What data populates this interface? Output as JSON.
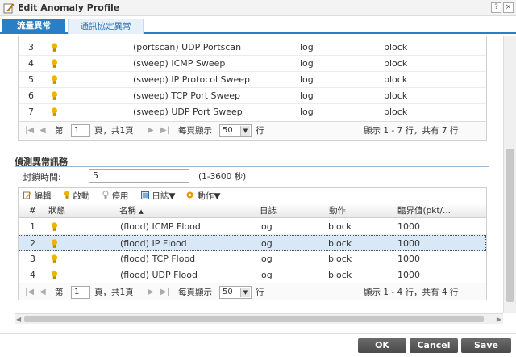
{
  "window": {
    "title": "Edit Anomaly Profile",
    "help_glyph": "?",
    "close_glyph": "×"
  },
  "tabs": [
    {
      "label": "流量異常"
    },
    {
      "label": "通訊協定異常"
    }
  ],
  "upper_table": {
    "rows": [
      {
        "no": "3",
        "name": "(portscan) UDP Portscan",
        "log": "log",
        "action": "block"
      },
      {
        "no": "4",
        "name": "(sweep) ICMP Sweep",
        "log": "log",
        "action": "block"
      },
      {
        "no": "5",
        "name": "(sweep) IP Protocol Sweep",
        "log": "log",
        "action": "block"
      },
      {
        "no": "6",
        "name": "(sweep) TCP Port Sweep",
        "log": "log",
        "action": "block"
      },
      {
        "no": "7",
        "name": "(sweep) UDP Port Sweep",
        "log": "log",
        "action": "block"
      }
    ],
    "pager": {
      "page_label": "第",
      "page_value": "1",
      "page_of": "頁，共1頁",
      "per_page_label": "每頁顯示",
      "per_page_value": "50",
      "per_page_unit": "行",
      "summary": "顯示 1 - 7 行，共有 7 行"
    }
  },
  "detect": {
    "section_title": "偵測異常訊務",
    "block_label": "封鎖時間:",
    "block_value": "5",
    "block_range": "(1-3600 秒)"
  },
  "lower_table": {
    "toolbar": {
      "edit": "編輯",
      "activate": "啟動",
      "deactivate": "停用",
      "log": "日誌",
      "action": "動作"
    },
    "headers": {
      "no": "#",
      "status": "狀態",
      "name": "名稱",
      "log": "日誌",
      "action": "動作",
      "threshold": "臨界值(pkt/..."
    },
    "rows": [
      {
        "no": "1",
        "name": "(flood) ICMP Flood",
        "log": "log",
        "action": "block",
        "threshold": "1000"
      },
      {
        "no": "2",
        "name": "(flood) IP Flood",
        "log": "log",
        "action": "block",
        "threshold": "1000"
      },
      {
        "no": "3",
        "name": "(flood) TCP Flood",
        "log": "log",
        "action": "block",
        "threshold": "1000"
      },
      {
        "no": "4",
        "name": "(flood) UDP Flood",
        "log": "log",
        "action": "block",
        "threshold": "1000"
      }
    ],
    "pager": {
      "page_label": "第",
      "page_value": "1",
      "page_of": "頁，共1頁",
      "per_page_label": "每頁顯示",
      "per_page_value": "50",
      "per_page_unit": "行",
      "summary": "顯示 1 - 4 行，共有 4 行"
    }
  },
  "footer": {
    "ok": "OK",
    "cancel": "Cancel",
    "save": "Save"
  },
  "colors": {
    "accent": "#2a7fc4",
    "bulb": "#f2b200",
    "button": "#555555",
    "selected_row": "#d9e8f6"
  },
  "icons": {
    "title": "edit-pencil-icon",
    "status": "lightbulb-icon"
  }
}
